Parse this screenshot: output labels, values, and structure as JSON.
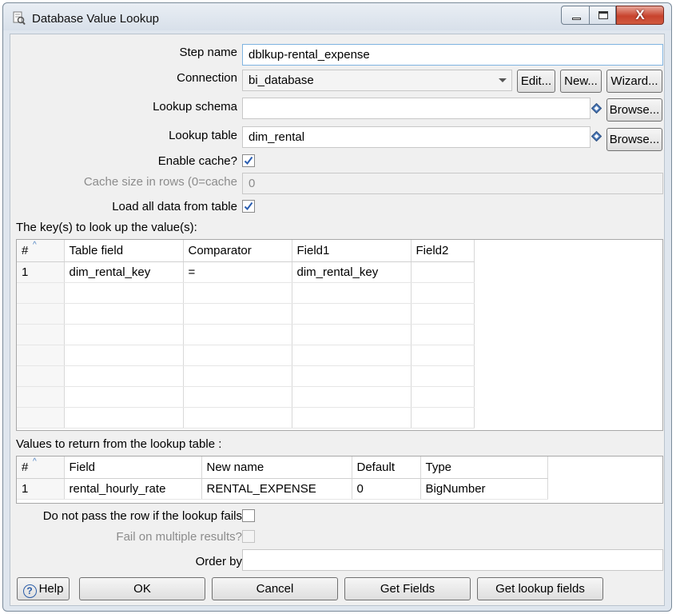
{
  "window": {
    "title": "Database Value Lookup",
    "close_glyph": "X"
  },
  "form": {
    "step_name_label": "Step name",
    "step_name_value": "dblkup-rental_expense",
    "connection_label": "Connection",
    "connection_value": "bi_database",
    "edit_button": "Edit...",
    "new_button": "New...",
    "wizard_button": "Wizard...",
    "lookup_schema_label": "Lookup schema",
    "lookup_schema_value": "",
    "browse_button": "Browse...",
    "lookup_table_label": "Lookup table",
    "lookup_table_value": "dim_rental",
    "enable_cache_label": "Enable cache?",
    "enable_cache_checked": true,
    "cache_size_label": "Cache size in rows (0=cache",
    "cache_size_value": "0",
    "load_all_label": "Load all data from table",
    "load_all_checked": true
  },
  "keys_table": {
    "label": "The key(s) to look up the value(s):",
    "columns": [
      "#",
      "Table field",
      "Comparator",
      "Field1",
      "Field2"
    ],
    "rows": [
      [
        "1",
        "dim_rental_key",
        "=",
        "dim_rental_key",
        ""
      ]
    ]
  },
  "values_table": {
    "label": "Values to return from the lookup table :",
    "columns": [
      "#",
      "Field",
      "New name",
      "Default",
      "Type"
    ],
    "rows": [
      [
        "1",
        "rental_hourly_rate",
        "RENTAL_EXPENSE",
        "0",
        "BigNumber"
      ]
    ]
  },
  "options": {
    "do_not_pass_label": "Do not pass the row if the lookup fails",
    "do_not_pass_checked": false,
    "fail_multiple_label": "Fail on multiple results?",
    "fail_multiple_checked": false,
    "order_by_label": "Order by",
    "order_by_value": ""
  },
  "buttons": {
    "help": "Help",
    "ok": "OK",
    "cancel": "Cancel",
    "get_fields": "Get Fields",
    "get_lookup_fields": "Get lookup fields"
  },
  "colors": {
    "check_mark": "#2a5db0",
    "close_button": "#c8432d"
  }
}
